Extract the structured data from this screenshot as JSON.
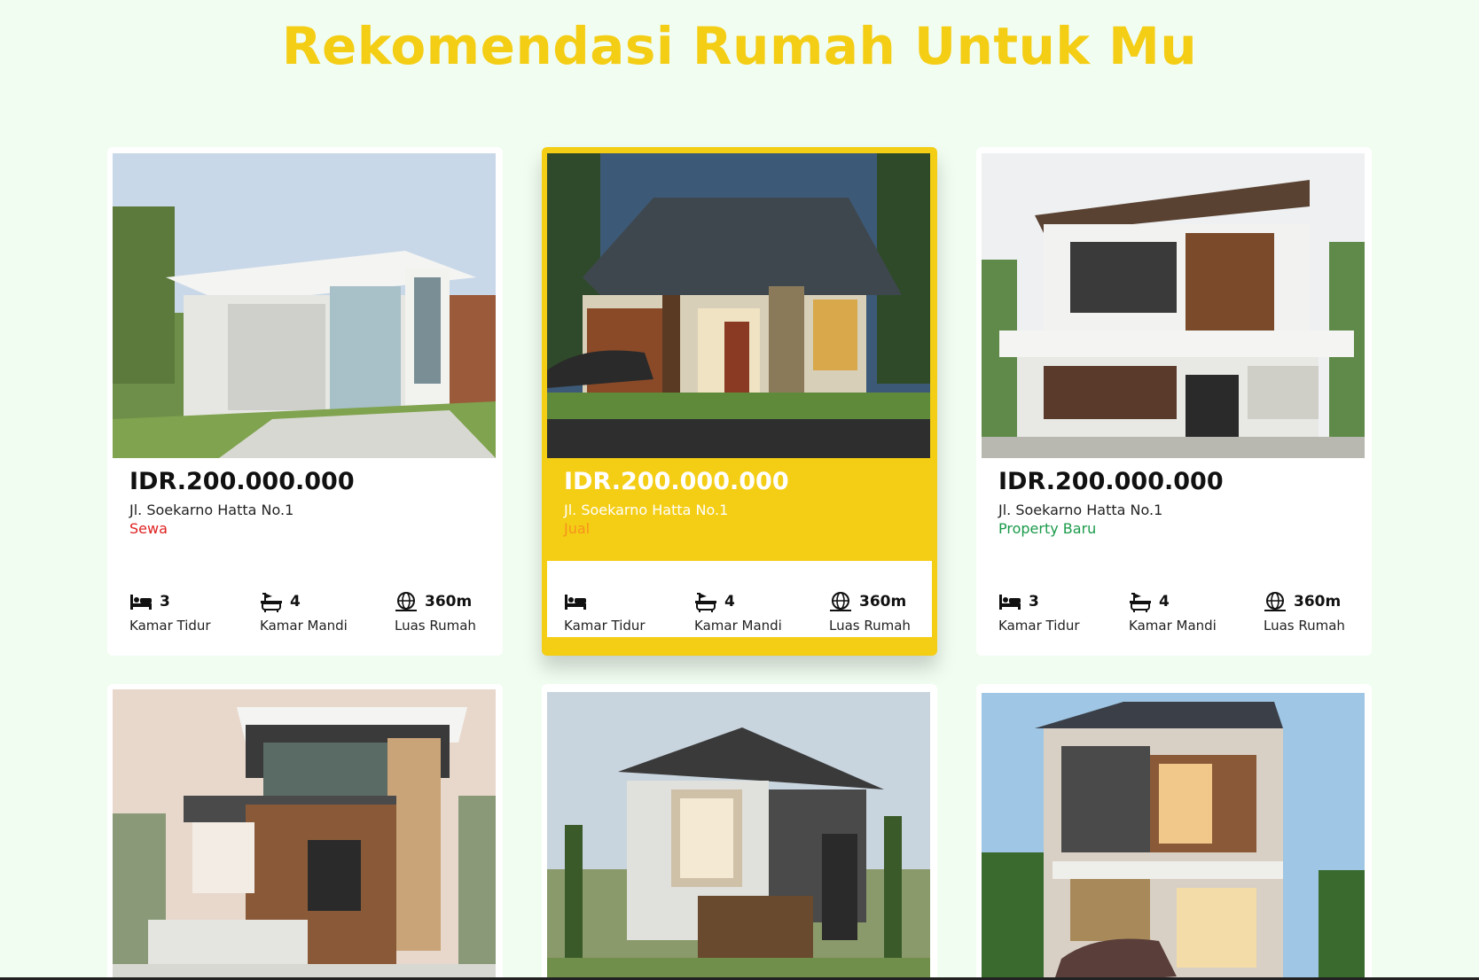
{
  "page": {
    "title": "Rekomendasi Rumah Untuk Mu"
  },
  "colors": {
    "accent": "#f4cd15",
    "sewa": "#e02020",
    "jual": "#f7931e",
    "baru": "#1a9a4a",
    "background": "#f1fdf1"
  },
  "listings": [
    {
      "price": "IDR.200.000.000",
      "address": "Jl. Soekarno Hatta No.1",
      "status": "Sewa",
      "status_color": "#e02020",
      "bedrooms": "3",
      "bedrooms_label": "Kamar Tidur",
      "bathrooms": "4",
      "bathrooms_label": "Kamar Mandi",
      "area": "360m",
      "area_label": "Luas Rumah"
    },
    {
      "price": "IDR.200.000.000",
      "address": "Jl. Soekarno Hatta No.1",
      "status": "Jual",
      "status_color": "#f7931e",
      "bedrooms": "",
      "bedrooms_label": "Kamar Tidur",
      "bathrooms": "4",
      "bathrooms_label": "Kamar Mandi",
      "area": "360m",
      "area_label": "Luas Rumah"
    },
    {
      "price": "IDR.200.000.000",
      "address": "Jl. Soekarno Hatta No.1",
      "status": "Property Baru",
      "status_color": "#1a9a4a",
      "bedrooms": "3",
      "bedrooms_label": "Kamar Tidur",
      "bathrooms": "4",
      "bathrooms_label": "Kamar Mandi",
      "area": "360m",
      "area_label": "Luas Rumah"
    }
  ],
  "icons": {
    "bed": "bed-icon",
    "bath": "bathtub-icon",
    "area": "globe-area-icon"
  }
}
